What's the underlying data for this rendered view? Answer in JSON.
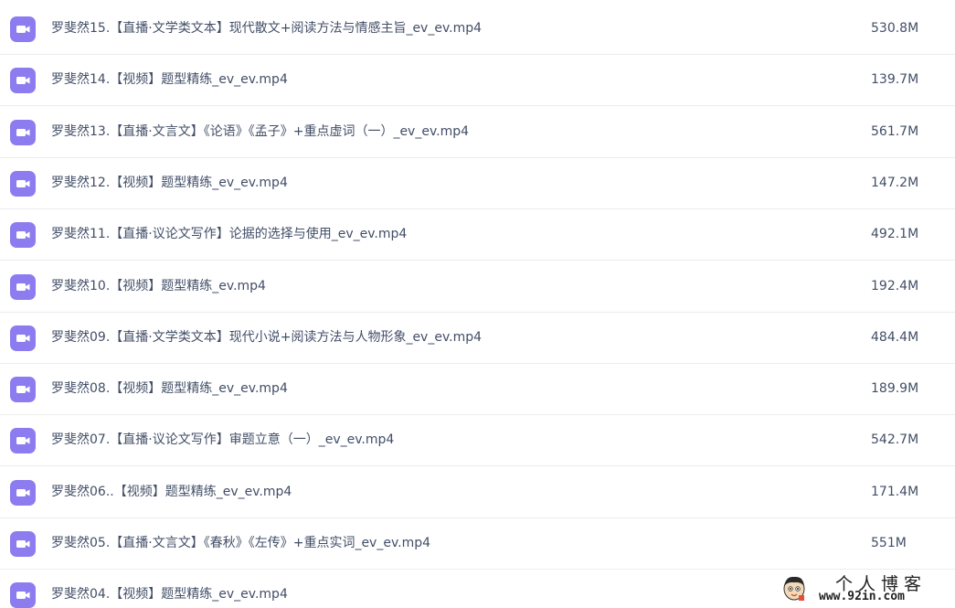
{
  "files": [
    {
      "name": "罗斐然15.【直播·文学类文本】现代散文+阅读方法与情感主旨_ev_ev.mp4",
      "size": "530.8M",
      "icon": "video-icon"
    },
    {
      "name": "罗斐然14.【视频】题型精练_ev_ev.mp4",
      "size": "139.7M",
      "icon": "video-icon"
    },
    {
      "name": "罗斐然13.【直播·文言文】《论语》《孟子》+重点虚词（一）_ev_ev.mp4",
      "size": "561.7M",
      "icon": "video-icon"
    },
    {
      "name": "罗斐然12.【视频】题型精练_ev_ev.mp4",
      "size": "147.2M",
      "icon": "video-icon"
    },
    {
      "name": "罗斐然11.【直播·议论文写作】论据的选择与使用_ev_ev.mp4",
      "size": "492.1M",
      "icon": "video-icon"
    },
    {
      "name": "罗斐然10.【视频】题型精练_ev.mp4",
      "size": "192.4M",
      "icon": "video-icon"
    },
    {
      "name": "罗斐然09.【直播·文学类文本】现代小说+阅读方法与人物形象_ev_ev.mp4",
      "size": "484.4M",
      "icon": "video-icon"
    },
    {
      "name": "罗斐然08.【视频】题型精练_ev_ev.mp4",
      "size": "189.9M",
      "icon": "video-icon"
    },
    {
      "name": "罗斐然07.【直播·议论文写作】审题立意（一）_ev_ev.mp4",
      "size": "542.7M",
      "icon": "video-icon"
    },
    {
      "name": "罗斐然06..【视频】题型精练_ev_ev.mp4",
      "size": "171.4M",
      "icon": "video-icon"
    },
    {
      "name": "罗斐然05.【直播·文言文】《春秋》《左传》+重点实词_ev_ev.mp4",
      "size": "551M",
      "icon": "video-icon"
    },
    {
      "name": "罗斐然04.【视频】题型精练_ev_ev.mp4",
      "size": "",
      "icon": "video-icon"
    }
  ],
  "watermark": {
    "title": "个人博客",
    "url": "www.92in.com"
  },
  "colors": {
    "icon_background": "#8c7cf0",
    "text": "#424e67",
    "divider": "#ececec"
  }
}
